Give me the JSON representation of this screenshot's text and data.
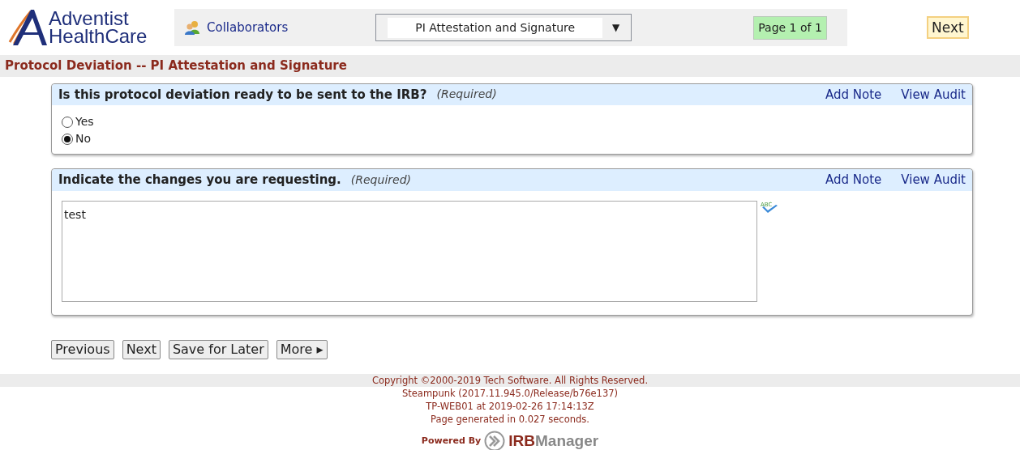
{
  "header": {
    "logo": {
      "line_1": "Adventist",
      "line_2": "HealthCare"
    },
    "collaborators_link": "Collaborators",
    "page_select": {
      "value": "PI Attestation and Signature",
      "arrow": "▼"
    },
    "page_indicator": "Page 1 of 1",
    "next_button": "Next"
  },
  "page_title": "Protocol Deviation -- PI Attestation and Signature",
  "questions": [
    {
      "kind": "radio",
      "question": "Is this protocol deviation ready to be sent to the IRB?",
      "required_label": "(Required)",
      "actions": [
        "Add Note",
        "View Audit"
      ],
      "options": [
        {
          "label": "Yes",
          "selected": false
        },
        {
          "label": "No",
          "selected": true
        }
      ]
    },
    {
      "kind": "textarea",
      "question": "Indicate the changes you are requesting.",
      "required_label": "(Required)",
      "actions": [
        "Add Note",
        "View Audit"
      ],
      "value": "test",
      "spellcheck_label": "ABC"
    }
  ],
  "buttons": [
    {
      "label": "Previous"
    },
    {
      "label": "Next"
    },
    {
      "label": "Save for Later"
    },
    {
      "label": "More",
      "arrow": "▸"
    }
  ],
  "footer": {
    "lines": [
      "Copyright ©2000-2019 Tech Software. All Rights Reserved.",
      "Steampunk (2017.11.945.0/Release/b76e137)",
      "TP-WEB01 at 2019-02-26 17:14:13Z",
      "Page generated in 0.027 seconds."
    ],
    "powered_by": "Powered By",
    "brand_bold": "IRB",
    "brand_rest": "Manager"
  }
}
